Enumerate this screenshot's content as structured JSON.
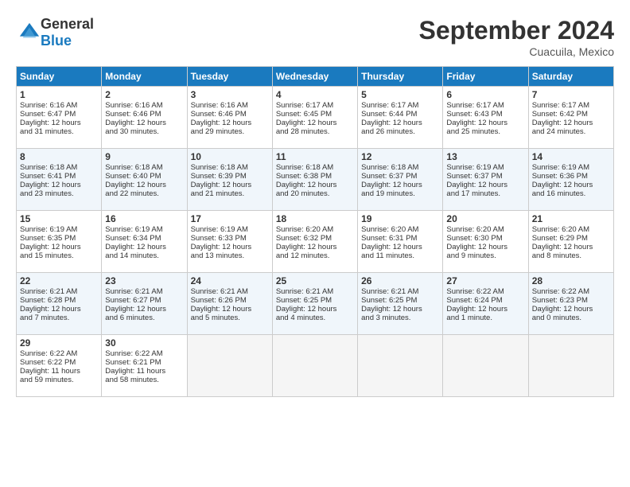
{
  "logo": {
    "general": "General",
    "blue": "Blue"
  },
  "header": {
    "month": "September 2024",
    "location": "Cuacuila, Mexico"
  },
  "weekdays": [
    "Sunday",
    "Monday",
    "Tuesday",
    "Wednesday",
    "Thursday",
    "Friday",
    "Saturday"
  ],
  "weeks": [
    [
      {
        "day": "1",
        "lines": [
          "Sunrise: 6:16 AM",
          "Sunset: 6:47 PM",
          "Daylight: 12 hours",
          "and 31 minutes."
        ]
      },
      {
        "day": "2",
        "lines": [
          "Sunrise: 6:16 AM",
          "Sunset: 6:46 PM",
          "Daylight: 12 hours",
          "and 30 minutes."
        ]
      },
      {
        "day": "3",
        "lines": [
          "Sunrise: 6:16 AM",
          "Sunset: 6:46 PM",
          "Daylight: 12 hours",
          "and 29 minutes."
        ]
      },
      {
        "day": "4",
        "lines": [
          "Sunrise: 6:17 AM",
          "Sunset: 6:45 PM",
          "Daylight: 12 hours",
          "and 28 minutes."
        ]
      },
      {
        "day": "5",
        "lines": [
          "Sunrise: 6:17 AM",
          "Sunset: 6:44 PM",
          "Daylight: 12 hours",
          "and 26 minutes."
        ]
      },
      {
        "day": "6",
        "lines": [
          "Sunrise: 6:17 AM",
          "Sunset: 6:43 PM",
          "Daylight: 12 hours",
          "and 25 minutes."
        ]
      },
      {
        "day": "7",
        "lines": [
          "Sunrise: 6:17 AM",
          "Sunset: 6:42 PM",
          "Daylight: 12 hours",
          "and 24 minutes."
        ]
      }
    ],
    [
      {
        "day": "8",
        "lines": [
          "Sunrise: 6:18 AM",
          "Sunset: 6:41 PM",
          "Daylight: 12 hours",
          "and 23 minutes."
        ]
      },
      {
        "day": "9",
        "lines": [
          "Sunrise: 6:18 AM",
          "Sunset: 6:40 PM",
          "Daylight: 12 hours",
          "and 22 minutes."
        ]
      },
      {
        "day": "10",
        "lines": [
          "Sunrise: 6:18 AM",
          "Sunset: 6:39 PM",
          "Daylight: 12 hours",
          "and 21 minutes."
        ]
      },
      {
        "day": "11",
        "lines": [
          "Sunrise: 6:18 AM",
          "Sunset: 6:38 PM",
          "Daylight: 12 hours",
          "and 20 minutes."
        ]
      },
      {
        "day": "12",
        "lines": [
          "Sunrise: 6:18 AM",
          "Sunset: 6:37 PM",
          "Daylight: 12 hours",
          "and 19 minutes."
        ]
      },
      {
        "day": "13",
        "lines": [
          "Sunrise: 6:19 AM",
          "Sunset: 6:37 PM",
          "Daylight: 12 hours",
          "and 17 minutes."
        ]
      },
      {
        "day": "14",
        "lines": [
          "Sunrise: 6:19 AM",
          "Sunset: 6:36 PM",
          "Daylight: 12 hours",
          "and 16 minutes."
        ]
      }
    ],
    [
      {
        "day": "15",
        "lines": [
          "Sunrise: 6:19 AM",
          "Sunset: 6:35 PM",
          "Daylight: 12 hours",
          "and 15 minutes."
        ]
      },
      {
        "day": "16",
        "lines": [
          "Sunrise: 6:19 AM",
          "Sunset: 6:34 PM",
          "Daylight: 12 hours",
          "and 14 minutes."
        ]
      },
      {
        "day": "17",
        "lines": [
          "Sunrise: 6:19 AM",
          "Sunset: 6:33 PM",
          "Daylight: 12 hours",
          "and 13 minutes."
        ]
      },
      {
        "day": "18",
        "lines": [
          "Sunrise: 6:20 AM",
          "Sunset: 6:32 PM",
          "Daylight: 12 hours",
          "and 12 minutes."
        ]
      },
      {
        "day": "19",
        "lines": [
          "Sunrise: 6:20 AM",
          "Sunset: 6:31 PM",
          "Daylight: 12 hours",
          "and 11 minutes."
        ]
      },
      {
        "day": "20",
        "lines": [
          "Sunrise: 6:20 AM",
          "Sunset: 6:30 PM",
          "Daylight: 12 hours",
          "and 9 minutes."
        ]
      },
      {
        "day": "21",
        "lines": [
          "Sunrise: 6:20 AM",
          "Sunset: 6:29 PM",
          "Daylight: 12 hours",
          "and 8 minutes."
        ]
      }
    ],
    [
      {
        "day": "22",
        "lines": [
          "Sunrise: 6:21 AM",
          "Sunset: 6:28 PM",
          "Daylight: 12 hours",
          "and 7 minutes."
        ]
      },
      {
        "day": "23",
        "lines": [
          "Sunrise: 6:21 AM",
          "Sunset: 6:27 PM",
          "Daylight: 12 hours",
          "and 6 minutes."
        ]
      },
      {
        "day": "24",
        "lines": [
          "Sunrise: 6:21 AM",
          "Sunset: 6:26 PM",
          "Daylight: 12 hours",
          "and 5 minutes."
        ]
      },
      {
        "day": "25",
        "lines": [
          "Sunrise: 6:21 AM",
          "Sunset: 6:25 PM",
          "Daylight: 12 hours",
          "and 4 minutes."
        ]
      },
      {
        "day": "26",
        "lines": [
          "Sunrise: 6:21 AM",
          "Sunset: 6:25 PM",
          "Daylight: 12 hours",
          "and 3 minutes."
        ]
      },
      {
        "day": "27",
        "lines": [
          "Sunrise: 6:22 AM",
          "Sunset: 6:24 PM",
          "Daylight: 12 hours",
          "and 1 minute."
        ]
      },
      {
        "day": "28",
        "lines": [
          "Sunrise: 6:22 AM",
          "Sunset: 6:23 PM",
          "Daylight: 12 hours",
          "and 0 minutes."
        ]
      }
    ],
    [
      {
        "day": "29",
        "lines": [
          "Sunrise: 6:22 AM",
          "Sunset: 6:22 PM",
          "Daylight: 11 hours",
          "and 59 minutes."
        ]
      },
      {
        "day": "30",
        "lines": [
          "Sunrise: 6:22 AM",
          "Sunset: 6:21 PM",
          "Daylight: 11 hours",
          "and 58 minutes."
        ]
      },
      {
        "day": "",
        "lines": []
      },
      {
        "day": "",
        "lines": []
      },
      {
        "day": "",
        "lines": []
      },
      {
        "day": "",
        "lines": []
      },
      {
        "day": "",
        "lines": []
      }
    ]
  ]
}
